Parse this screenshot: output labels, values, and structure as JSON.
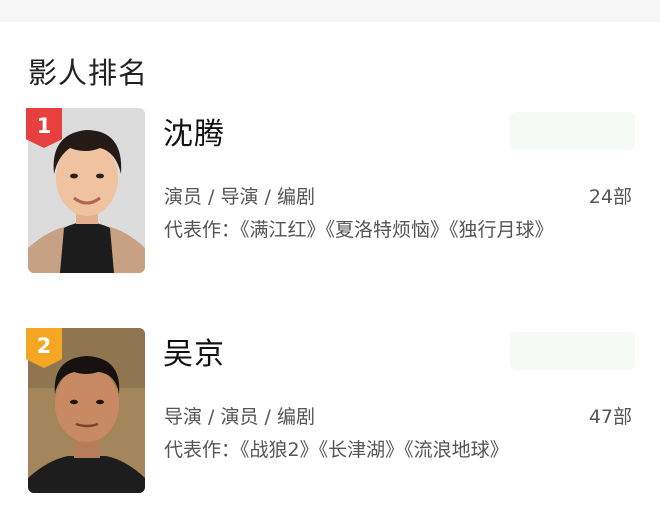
{
  "section": {
    "title": "影人排名"
  },
  "people": [
    {
      "rank": "1",
      "name": "沈腾",
      "roles": "演员 / 导演 / 编剧",
      "count": "24部",
      "works_label": "代表作：",
      "works": "《满江红》《夏洛特烦恼》《独行月球》",
      "badge_color": "#e8403e"
    },
    {
      "rank": "2",
      "name": "吴京",
      "roles": "导演 / 演员 / 编剧",
      "count": "47部",
      "works_label": "代表作：",
      "works": "《战狼2》《长津湖》《流浪地球》",
      "badge_color": "#f5a623"
    }
  ]
}
